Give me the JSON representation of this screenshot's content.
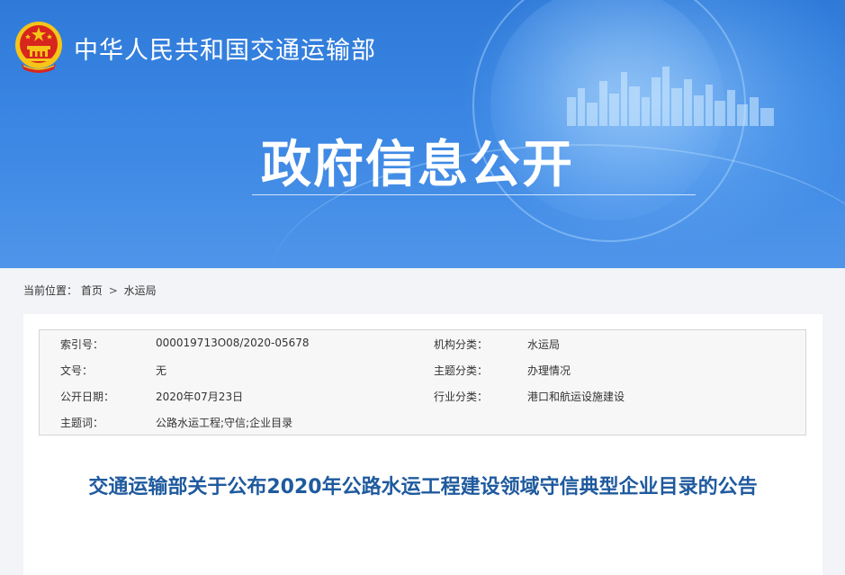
{
  "header": {
    "site_title": "中华人民共和国交通运输部",
    "hero_title": "政府信息公开"
  },
  "breadcrumb": {
    "label": "当前位置：",
    "home": "首页",
    "separator": ">",
    "current": "水运局"
  },
  "meta": {
    "index_label": "索引号：",
    "index_value": "000019713O08/2020-05678",
    "org_label": "机构分类：",
    "org_value": "水运局",
    "docno_label": "文号：",
    "docno_value": "无",
    "topic_label": "主题分类：",
    "topic_value": "办理情况",
    "date_label": "公开日期：",
    "date_value": "2020年07月23日",
    "industry_label": "行业分类：",
    "industry_value": "港口和航运设施建设",
    "keywords_label": "主题词：",
    "keywords_value": "公路水运工程;守信;企业目录"
  },
  "article": {
    "title": "交通运输部关于公布2020年公路水运工程建设领域守信典型企业目录的公告"
  },
  "colors": {
    "banner": "#3a86e3",
    "title_blue": "#1f5a9e",
    "emblem_red": "#d7261e",
    "emblem_gold": "#f5c518"
  }
}
